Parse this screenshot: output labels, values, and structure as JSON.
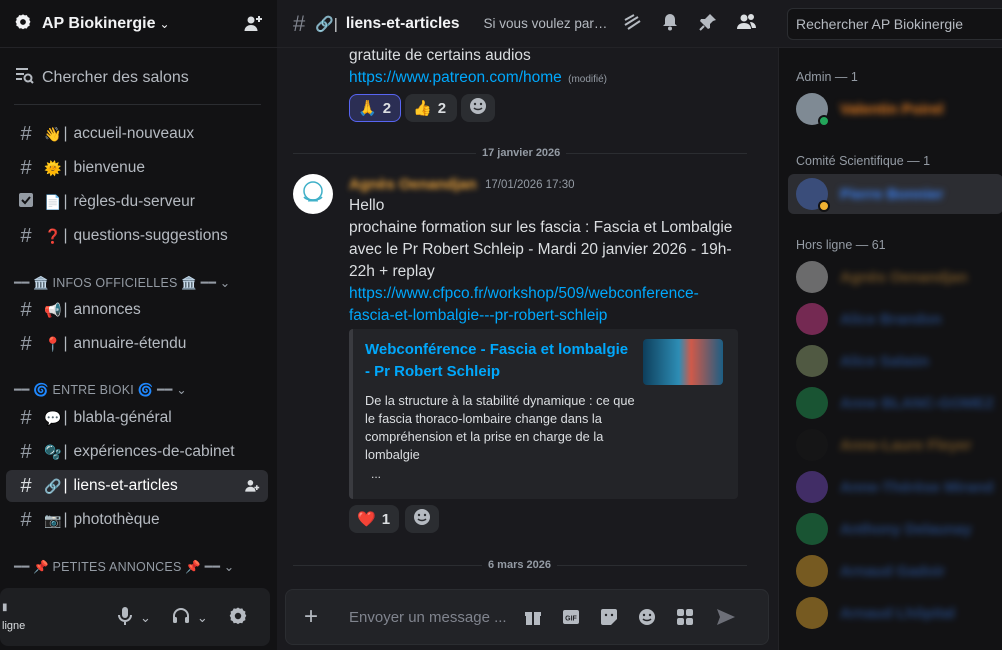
{
  "server": {
    "name": "AP Biokinergie"
  },
  "sidebar": {
    "search_label": "Chercher des salons",
    "channels": [
      {
        "name": "accueil-nouveaux",
        "emoji": "👋"
      },
      {
        "name": "bienvenue",
        "emoji": "🌞"
      },
      {
        "name": "règles-du-serveur",
        "emoji": "📄"
      },
      {
        "name": "questions-suggestions",
        "emoji": "❓"
      },
      {
        "name": "annonces",
        "emoji": "📢"
      },
      {
        "name": "annuaire-étendu",
        "emoji": "📍"
      },
      {
        "name": "blabla-général",
        "emoji": "💬"
      },
      {
        "name": "expériences-de-cabinet",
        "emoji": "🫧"
      },
      {
        "name": "liens-et-articles",
        "emoji": "🔗"
      },
      {
        "name": "photothèque",
        "emoji": "📷"
      }
    ],
    "categories": [
      "━━ 🏛️ INFOS OFFICIELLES 🏛️ ━━",
      "━━ 🌀 ENTRE BIOKI 🌀 ━━",
      "━━ 📌 PETITES ANNONCES 📌 ━━"
    ]
  },
  "user_panel": {
    "status": "ligne"
  },
  "topbar": {
    "channel": "liens-et-articles",
    "topic": "Si vous voulez partager des liens",
    "search_placeholder": "Rechercher AP Biokinergie"
  },
  "chat": {
    "prev_line": "gratuite de certains audios",
    "prev_link": "https://www.patreon.com/home",
    "edited": "(modifié)",
    "prev_reactions": [
      {
        "emoji": "🙏",
        "count": "2"
      },
      {
        "emoji": "👍",
        "count": "2"
      }
    ],
    "date1": "17 janvier 2026",
    "author": "Agnès Oenandjan",
    "timestamp": "17/01/2026 17:30",
    "body_line1": "Hello",
    "body_line2": "prochaine formation sur les fascia : Fascia et Lombalgie",
    "body_line3": "avec le Pr Robert Schleip - Mardi 20 janvier 2026 - 19h-",
    "body_line4": "22h + replay",
    "link_line1": "https://www.cfpco.fr/workshop/509/webconference-",
    "link_line2": "fascia-et-lombalgie---pr-robert-schleip",
    "embed": {
      "title": "Webconférence - Fascia et lombalgie - Pr Robert Schleip",
      "description": "De la structure à la stabilité dynamique : ce que le fascia thoraco-lombaire change dans la compréhension et la prise en charge de la lombalgie",
      "more": "..."
    },
    "reactions": [
      {
        "emoji": "❤️",
        "count": "1"
      }
    ],
    "date2": "6 mars 2026",
    "composer_placeholder": "Envoyer un message ..."
  },
  "members": {
    "groups": [
      {
        "label": "Admin — 1"
      },
      {
        "label": "Comité Scientifique — 1"
      },
      {
        "label": "Hors ligne — 61"
      }
    ],
    "list": [
      {
        "name": "Valentin Poirel",
        "color": "#e67e22"
      },
      {
        "name": "Pierre Bonnier",
        "color": "#3b82f6"
      },
      {
        "name": "Agnès Oenandjan",
        "color": "#e8a23c"
      },
      {
        "name": "Alice Brandon",
        "color": "#3b82f6"
      },
      {
        "name": "Alice Salaün",
        "color": "#3b82f6"
      },
      {
        "name": "Anne BLANC-GOMEZ",
        "color": "#3b82f6"
      },
      {
        "name": "Anne-Laure Fleyer",
        "color": "#e8a23c"
      },
      {
        "name": "Anne-Thérèse Mirand",
        "color": "#3b82f6"
      },
      {
        "name": "Anthony Delaunay",
        "color": "#3b82f6"
      },
      {
        "name": "Arnaud Gadoir",
        "color": "#3b82f6"
      },
      {
        "name": "Arnaud Lhôpital",
        "color": "#3b82f6"
      }
    ]
  },
  "colors": {
    "accent": "#5865f2",
    "link": "#00a8fc",
    "online": "#23a55a",
    "idle": "#f0b232"
  }
}
